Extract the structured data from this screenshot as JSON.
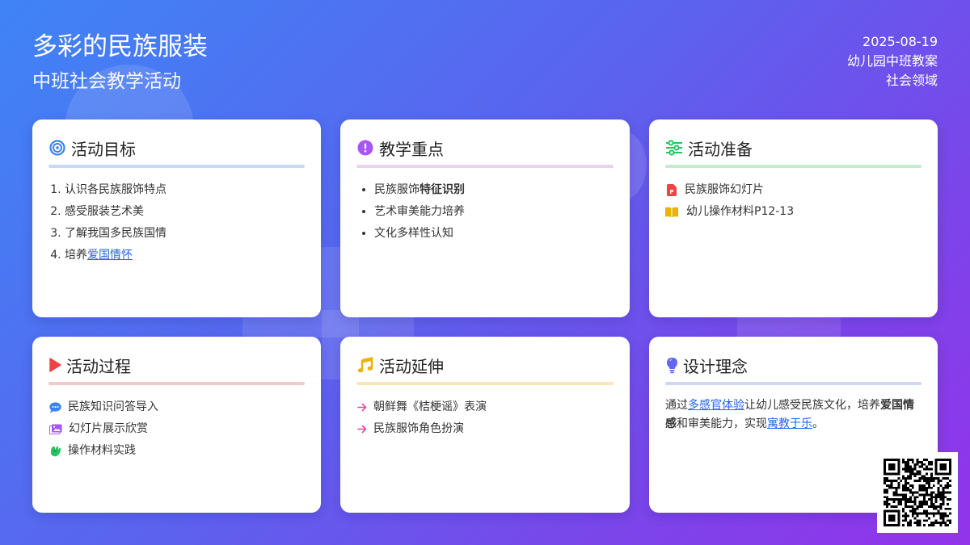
{
  "header": {
    "title": "多彩的民族服装",
    "subtitle": "中班社会教学活动",
    "date": "2025-08-19",
    "class": "幼儿园中班教案",
    "domain": "社会领域"
  },
  "cards": {
    "goals": {
      "title": "活动目标",
      "icon": "target-icon",
      "accent": "#c7daf3",
      "items": [
        "认识各民族服饰特点",
        "感受服装艺术美",
        "了解我国多民族国情"
      ],
      "item4_prefix": "培养",
      "item4_link": "爱国情怀"
    },
    "keypoints": {
      "title": "教学重点",
      "icon": "exclamation-icon",
      "accent": "#ecd2f0",
      "item1_prefix": "民族服饰",
      "item1_bold": "特征识别",
      "item2": "艺术审美能力培养",
      "item3": "文化多样性认知"
    },
    "prep": {
      "title": "活动准备",
      "icon": "sliders-icon",
      "accent": "#c3ecd1",
      "items": [
        {
          "icon": "ppt-file-icon",
          "text": "民族服饰幻灯片"
        },
        {
          "icon": "book-icon",
          "text": "幼儿操作材料P12-13"
        }
      ]
    },
    "process": {
      "title": "活动过程",
      "icon": "play-icon",
      "accent": "#f5c9c9",
      "items": [
        {
          "icon": "chat-icon",
          "text": "民族知识问答导入"
        },
        {
          "icon": "images-icon",
          "text": "幻灯片展示欣赏"
        },
        {
          "icon": "hands-icon",
          "text": "操作材料实践"
        }
      ]
    },
    "extension": {
      "title": "活动延伸",
      "icon": "music-icon",
      "accent": "#f6e6b8",
      "items": [
        {
          "icon": "arrow-right-icon",
          "text": "朝鲜舞《桔梗谣》表演"
        },
        {
          "icon": "arrow-right-icon",
          "text": "民族服饰角色扮演"
        }
      ]
    },
    "concept": {
      "title": "设计理念",
      "icon": "lightbulb-icon",
      "accent": "#d1d5f7",
      "p1": "通过",
      "link1": "多感官体验",
      "p2": "让幼儿感受民族文化，培养",
      "bold1": "爱国情感",
      "p3": "和审美能力，实现",
      "link2": "寓教于乐",
      "p4": "。"
    }
  },
  "colors": {
    "bg_start": "#3f84f6",
    "bg_end": "#9333ea",
    "link": "#2563eb"
  }
}
